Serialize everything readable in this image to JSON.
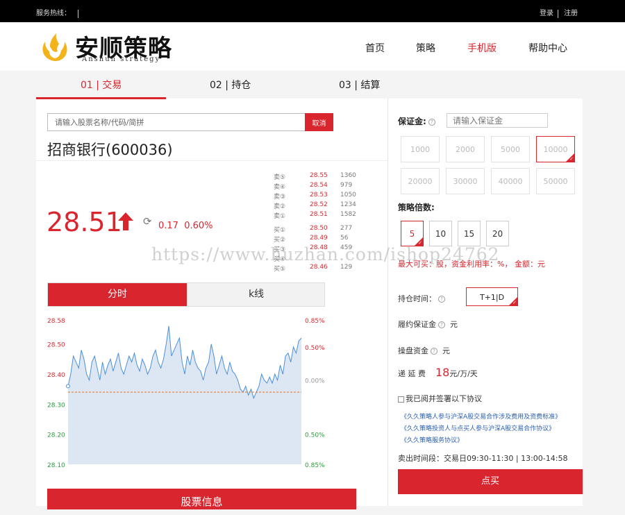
{
  "topbar": {
    "hotline": "服务热线：",
    "login": "登录",
    "register": "注册"
  },
  "logo": {
    "name": "安顺策略",
    "sub": "Anshun strategy"
  },
  "nav": [
    "首页",
    "策略",
    "手机版",
    "帮助中心"
  ],
  "steps": [
    "01 | 交易",
    "02 | 持仓",
    "03 | 结算"
  ],
  "search": {
    "placeholder": "请输入股票名称/代码/简拼",
    "cancel": "取消"
  },
  "stock": {
    "name": "招商银行(600036)",
    "price": "28.51",
    "change": "0.17",
    "change_pct": "0.60%"
  },
  "order_book": {
    "sell": [
      {
        "label": "卖⑤",
        "price": "28.55",
        "vol": "1360"
      },
      {
        "label": "卖④",
        "price": "28.54",
        "vol": "979"
      },
      {
        "label": "卖③",
        "price": "28.53",
        "vol": "1050"
      },
      {
        "label": "卖②",
        "price": "28.52",
        "vol": "1234"
      },
      {
        "label": "卖①",
        "price": "28.51",
        "vol": "1582"
      }
    ],
    "buy": [
      {
        "label": "买①",
        "price": "28.50",
        "vol": "277"
      },
      {
        "label": "买②",
        "price": "28.49",
        "vol": "56"
      },
      {
        "label": "买③",
        "price": "28.48",
        "vol": "459"
      },
      {
        "label": "买④",
        "price": "",
        "vol": ""
      },
      {
        "label": "买⑤",
        "price": "28.46",
        "vol": "129"
      }
    ]
  },
  "chart_tabs": [
    "分时",
    "k线"
  ],
  "chart_data": {
    "type": "area",
    "title": "",
    "xlabel": "",
    "ylabel": "",
    "ylim": [
      28.1,
      28.58
    ],
    "y_ticks_left": [
      "28.58",
      "28.50",
      "28.40",
      "28.30",
      "28.20",
      "28.10"
    ],
    "y_ticks_right": [
      "0.85%",
      "0.50%",
      "0.00%",
      "0.50%",
      "0.85%"
    ],
    "baseline": 28.34,
    "values": [
      28.36,
      28.4,
      28.46,
      28.44,
      28.42,
      28.48,
      28.45,
      28.4,
      28.38,
      28.44,
      28.46,
      28.42,
      28.38,
      28.44,
      28.4,
      28.43,
      28.45,
      28.41,
      28.44,
      28.47,
      28.42,
      28.4,
      28.43,
      28.46,
      28.44,
      28.47,
      28.43,
      28.41,
      28.45,
      28.43,
      28.4,
      28.42,
      28.46,
      28.48,
      28.44,
      28.42,
      28.45,
      28.5,
      28.56,
      28.46,
      28.48,
      28.5,
      28.52,
      28.44,
      28.4,
      28.46,
      28.43,
      28.48,
      28.44,
      28.42,
      28.41,
      28.38,
      28.42,
      28.44,
      28.5,
      28.46,
      28.4,
      28.43,
      28.46,
      28.42,
      28.4,
      28.44,
      28.41,
      28.4,
      28.38,
      28.35,
      28.34,
      28.36,
      28.33,
      28.35,
      28.32,
      28.34,
      28.36,
      28.4,
      28.38,
      28.37,
      28.39,
      28.37,
      28.4,
      28.38,
      28.43,
      28.4,
      28.46,
      28.47,
      28.44,
      28.49,
      28.47,
      28.51,
      28.52
    ]
  },
  "stock_info_label": "股票信息",
  "watermark": "https://www.huzhan.com/ishop24762",
  "right": {
    "margin_label": "保证金:",
    "margin_placeholder": "请输入保证金",
    "amounts": [
      "1000",
      "2000",
      "5000",
      "10000",
      "20000",
      "30000",
      "40000",
      "50000"
    ],
    "multiple_label": "策略倍数:",
    "multiples": [
      "5",
      "10",
      "15",
      "20"
    ],
    "max_buy": "最大可买：股，资金利用率：%， 金额：元",
    "hold_label": "持仓时间：",
    "hold_value": "T+1|D",
    "deposit_label": "履约保证金",
    "deposit_unit": "元",
    "fund_label": "操盘资金",
    "fund_unit": "元",
    "fee_label": "递 延 费",
    "fee_value": "18",
    "fee_unit": "元/万/天",
    "agree": "我已阅并签署以下协议",
    "links": [
      "《久久策略人参与沪深A股交易合作涉及费用及资费标准》",
      "《久久策略投资人与点买人参与沪深A股交易合作协议》",
      "《久久策略服务协议》"
    ],
    "sell_time": "卖出时间段：交易日09:30-11:30 | 13:00-14:58",
    "buy": "点买"
  },
  "colors": {
    "accent": "#d9262e",
    "chart_fill": "#dde7f3",
    "chart_line": "#4a90d9",
    "baseline": "#e8874a"
  }
}
